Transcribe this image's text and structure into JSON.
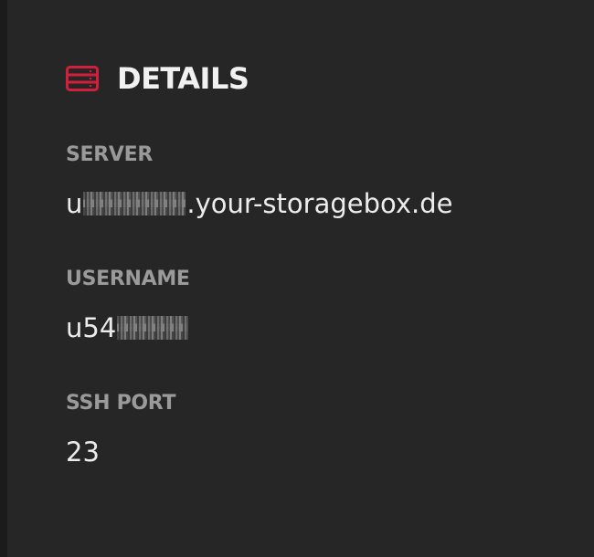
{
  "panel": {
    "title": "DETAILS",
    "icon": "server-icon",
    "accent_color": "#d21f3c"
  },
  "fields": [
    {
      "label": "SERVER",
      "value_prefix": "u",
      "value_suffix": ".your-storagebox.de"
    },
    {
      "label": "USERNAME",
      "value_prefix": "u54",
      "value_suffix": ""
    },
    {
      "label": "SSH PORT",
      "value_prefix": "23",
      "value_suffix": ""
    }
  ]
}
